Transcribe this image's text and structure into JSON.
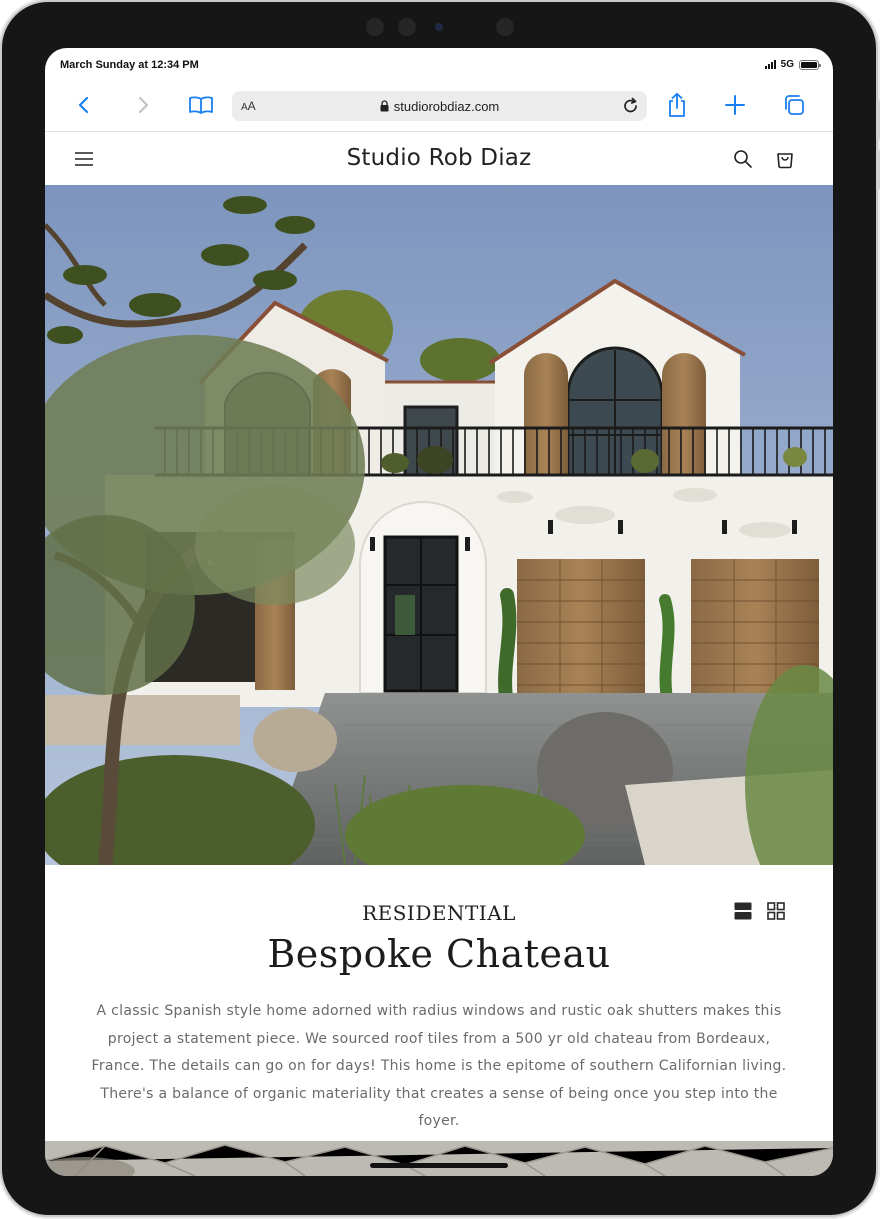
{
  "status_bar": {
    "time": "March Sunday at 12:34 PM",
    "network": "5G"
  },
  "browser": {
    "text_size_label": "AA",
    "url": "studiorobdiaz.com",
    "icons": [
      "back-icon",
      "forward-icon",
      "bookmarks-icon",
      "lock-icon",
      "reload-icon",
      "share-icon",
      "new-tab-icon",
      "tabs-icon"
    ]
  },
  "site": {
    "title": "Studio Rob Diaz",
    "icons": [
      "menu-icon",
      "search-icon",
      "cart-icon"
    ]
  },
  "project": {
    "category": "RESIDENTIAL",
    "title": "Bespoke Chateau",
    "description": "A classic Spanish style home adorned with radius windows and rustic oak shutters makes this project a statement piece. We sourced roof tiles from a 500 yr old chateau from Bordeaux, France. The details can go on for days! This home is the epitome of southern Californian living. There's a balance of organic materiality that creates a sense of being once you step into the foyer."
  },
  "view_options": [
    "list-view-icon",
    "grid-view-icon"
  ],
  "colors": {
    "device_frame": "#161616",
    "ios_blue": "#1a7ff0",
    "text_dark": "#1c1c1c",
    "text_muted": "#6a6a6a",
    "urlbar_bg": "#ececec"
  }
}
